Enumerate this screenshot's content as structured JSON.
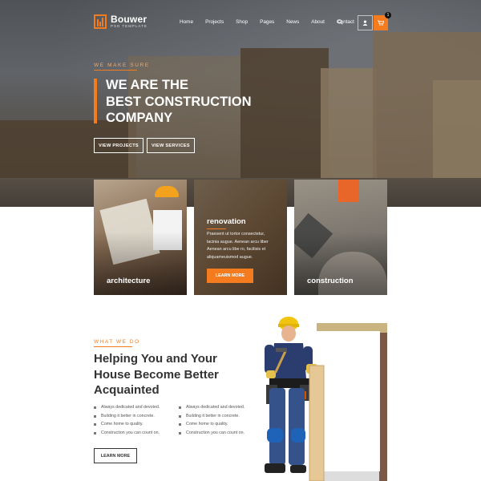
{
  "brand": {
    "name": "Bouwer",
    "subtitle": "PSD TEMPLATE",
    "accent": "#f47c1e"
  },
  "nav": {
    "items": [
      "Home",
      "Projects",
      "Shop",
      "Pages",
      "News",
      "About",
      "Contact"
    ],
    "cart_count": "1",
    "icons": [
      "search-icon",
      "user-icon",
      "cart-icon"
    ]
  },
  "hero": {
    "eyebrow": "WE MAKE SURE",
    "title_line1": "WE ARE THE",
    "title_line2": "BEST CONSTRUCTION",
    "title_line3": "COMPANY",
    "btn_projects": "VIEW PROJECTS",
    "btn_services": "VIEW SERVICES"
  },
  "services": {
    "card1_label": "architecture",
    "card2_title": "renovation",
    "card2_body_line1": "Praesent ut tortor consectetur,",
    "card2_body_line2": "lacinia augue. Aenean arcu liber",
    "card2_body_line3": "Aenean arcu libe ro, facilisis et",
    "card2_body_line4": "aliquameuismod augue.",
    "card2_button": "LEARN MORE",
    "card3_label": "construction"
  },
  "what_we_do": {
    "eyebrow": "WHAT WE DO",
    "title_line1": "Helping You and Your",
    "title_line2": "House Become Better",
    "title_line3": "Acquainted",
    "list_left": [
      "Always dedicated and devoted.",
      "Building it better in concrete.",
      "Come home to quality.",
      "Construction you can count on."
    ],
    "list_right": [
      "Always dedicated and devoted.",
      "Building it better in concrete.",
      "Come home to quality.",
      "Construction you can count on."
    ],
    "button": "LEARN MORE"
  }
}
